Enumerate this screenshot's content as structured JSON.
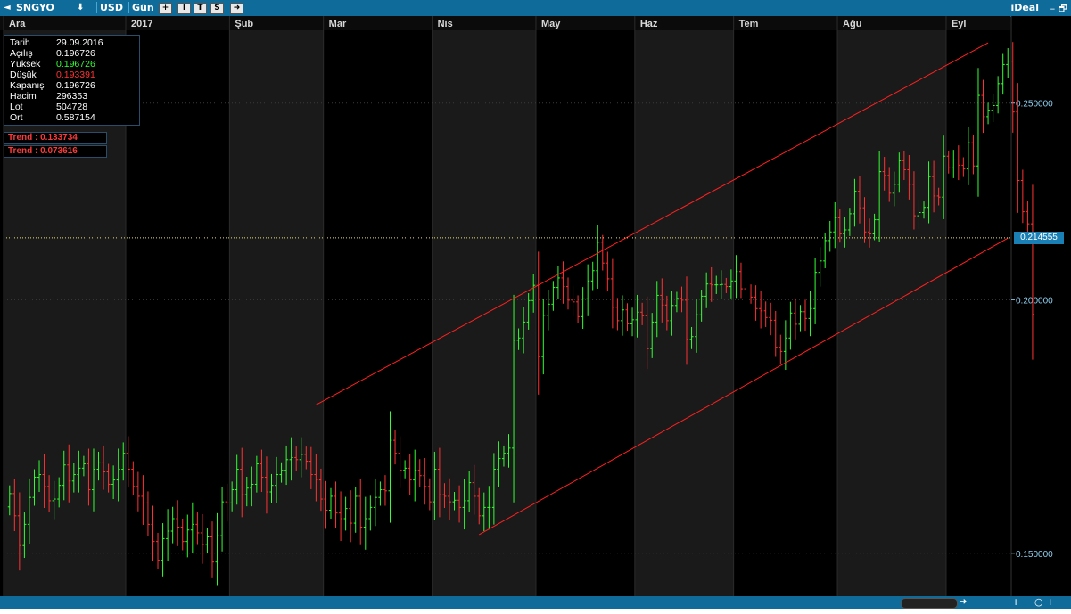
{
  "toolbar": {
    "back_arrow": "◄",
    "symbol": "SNGYO",
    "down_arrow": "⬇",
    "currency": "USD",
    "period": "Gün",
    "btn_plus": "+",
    "btn_i": "I",
    "btn_t": "T",
    "btn_s": "S",
    "btn_forward": "➜",
    "brand": "iDeal",
    "win_controls": "– 🗗"
  },
  "info": {
    "rows": [
      {
        "label": "Tarih",
        "value": "29.09.2016",
        "color": "#ffffff"
      },
      {
        "label": "Açılış",
        "value": "0.196726",
        "color": "#ffffff"
      },
      {
        "label": "Yüksek",
        "value": "0.196726",
        "color": "#33ff33"
      },
      {
        "label": "Düşük",
        "value": "0.193391",
        "color": "#ff3333"
      },
      {
        "label": "Kapanış",
        "value": "0.196726",
        "color": "#ffffff"
      },
      {
        "label": "Hacim",
        "value": "296353",
        "color": "#ffffff"
      },
      {
        "label": "Lot",
        "value": "504728",
        "color": "#ffffff"
      },
      {
        "label": "Ort",
        "value": "0.587154",
        "color": "#ffffff"
      }
    ]
  },
  "trends": [
    {
      "text": "Trend  :  0.133734"
    },
    {
      "text": "Trend  :  0.073616"
    }
  ],
  "bottom": {
    "scroll_right": "➜",
    "controls": "+ −  ○  + −"
  },
  "chart_data": {
    "type": "ohlc",
    "ylim": [
      0.143,
      0.271
    ],
    "yticks": [
      0.15,
      0.2,
      0.25
    ],
    "ytick_labels": [
      "0.150000",
      "0.200000",
      "0.250000"
    ],
    "months": [
      {
        "label": "Ara",
        "start": 0
      },
      {
        "label": "2017",
        "start": 24
      },
      {
        "label": "Şub",
        "start": 45
      },
      {
        "label": "Mar",
        "start": 64
      },
      {
        "label": "Nis",
        "start": 86
      },
      {
        "label": "May",
        "start": 107
      },
      {
        "label": "Haz",
        "start": 127
      },
      {
        "label": "Tem",
        "start": 147
      },
      {
        "label": "Ağu",
        "start": 168
      },
      {
        "label": "Eyl",
        "start": 190
      }
    ],
    "bar_count": 203,
    "current_price": 0.214555,
    "current_price_label": "0.214555",
    "channel": {
      "upper": [
        [
          62,
          0.1775
        ],
        [
          198,
          0.2677
        ]
      ],
      "lower": [
        [
          95,
          0.1532
        ],
        [
          202,
          0.2145
        ]
      ]
    },
    "up_color": "#33ff33",
    "down_color": "#ff3333",
    "channel_color": "#ff2020",
    "price_line_color": "#e6e07a",
    "shade_color": "#1a1a1a",
    "closes": [
      0.1605,
      0.1565,
      0.1513,
      0.155,
      0.1598,
      0.1635,
      0.164,
      0.1618,
      0.1592,
      0.1595,
      0.162,
      0.1658,
      0.1628,
      0.164,
      0.1652,
      0.166,
      0.1612,
      0.165,
      0.1662,
      0.1645,
      0.1622,
      0.163,
      0.165,
      0.168,
      0.165,
      0.1618,
      0.16,
      0.1588,
      0.155,
      0.152,
      0.1488,
      0.1525,
      0.1538,
      0.156,
      0.1545,
      0.152,
      0.154,
      0.155,
      0.1535,
      0.1515,
      0.1528,
      0.1485,
      0.153,
      0.159,
      0.1588,
      0.1612,
      0.165,
      0.1603,
      0.1615,
      0.1622,
      0.166,
      0.1635,
      0.1608,
      0.162,
      0.164,
      0.1648,
      0.1668,
      0.1672,
      0.1668,
      0.1678,
      0.1665,
      0.164,
      0.163,
      0.1595,
      0.1575,
      0.16,
      0.157,
      0.156,
      0.1578,
      0.1552,
      0.16,
      0.1545,
      0.156,
      0.158,
      0.1598,
      0.1612,
      0.161,
      0.1705,
      0.168,
      0.1648,
      0.1652,
      0.163,
      0.1648,
      0.1638,
      0.1618,
      0.159,
      0.165,
      0.1603,
      0.16,
      0.159,
      0.1593,
      0.158,
      0.1592,
      0.1625,
      0.16,
      0.1565,
      0.158,
      0.158,
      0.165,
      0.167,
      0.168,
      0.169,
      0.191,
      0.1915,
      0.195,
      0.1998,
      0.2033,
      0.1875,
      0.1965,
      0.199,
      0.2028,
      0.205,
      0.203,
      0.1999,
      0.1995,
      0.1962,
      0.2002,
      0.2043,
      0.2067,
      0.2135,
      0.2085,
      0.2048,
      0.1983,
      0.1953,
      0.1977,
      0.1946,
      0.1955,
      0.1972,
      0.1964,
      0.1892,
      0.195,
      0.201,
      0.1988,
      0.1953,
      0.1987,
      0.2003,
      0.1999,
      0.1912,
      0.1918,
      0.1966,
      0.2008,
      0.2036,
      0.2034,
      0.2034,
      0.2035,
      0.203,
      0.2043,
      0.2065,
      0.2025,
      0.202,
      0.2006,
      0.198,
      0.1975,
      0.196,
      0.1954,
      0.1895,
      0.1886,
      0.1915,
      0.197,
      0.1945,
      0.1973,
      0.1958,
      0.198,
      0.2063,
      0.209,
      0.2139,
      0.216,
      0.2195,
      0.2155,
      0.2165,
      0.2205,
      0.2262,
      0.222,
      0.216,
      0.2155,
      0.219,
      0.2313,
      0.2303,
      0.2257,
      0.228,
      0.2342,
      0.2318,
      0.228,
      0.22,
      0.2208,
      0.2221,
      0.23,
      0.225,
      0.2247,
      0.2354,
      0.2323,
      0.2344,
      0.233,
      0.232,
      0.239,
      0.2328,
      0.2522,
      0.2462,
      0.248,
      0.2493,
      0.2556,
      0.2612,
      0.2622,
      0.2475,
      0.229,
      0.221,
      0.218,
      0.1967
    ]
  }
}
